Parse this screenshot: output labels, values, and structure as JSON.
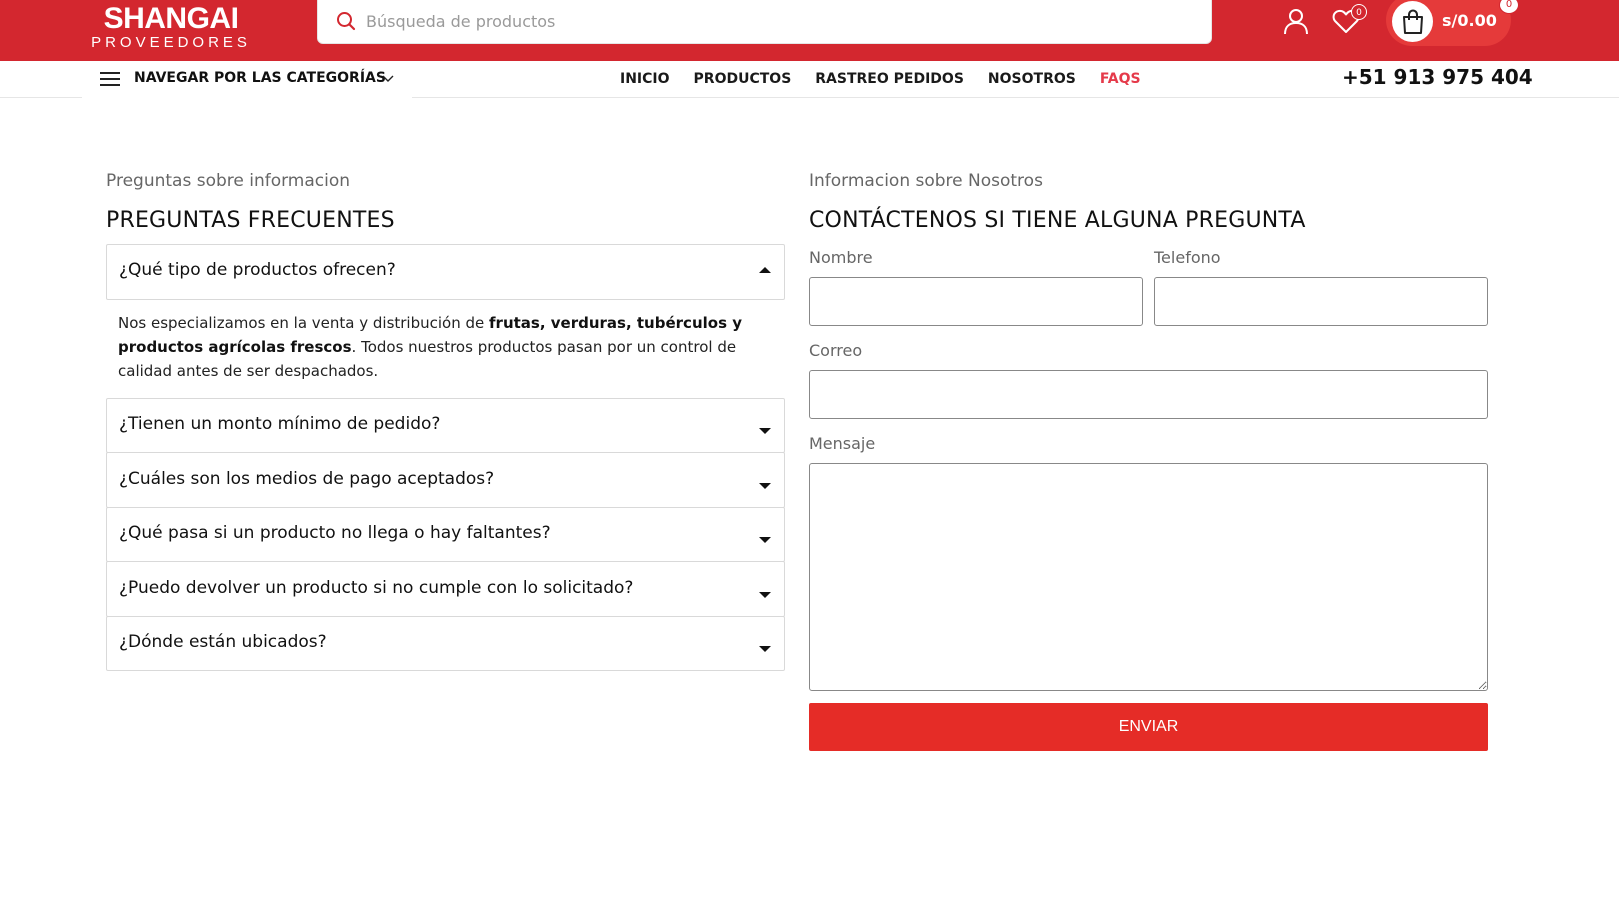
{
  "header": {
    "logo_main": "SHANGAI",
    "logo_sub": "PROVEEDORES",
    "search_placeholder": "Búsqueda de productos",
    "wishlist_count": "0",
    "cart_total": "s/0.00",
    "cart_count": "0",
    "brand_color": "#d3272f"
  },
  "nav": {
    "categories_label": "NAVEGAR POR LAS CATEGORÍAS",
    "links": [
      "INICIO",
      "PRODUCTOS",
      "RASTREO PEDIDOS",
      "NOSOTROS",
      "FAQS"
    ],
    "active_link": "FAQS",
    "phone": "+51 913 975 404"
  },
  "faq": {
    "subtitle": "Preguntas sobre informacion",
    "title": "PREGUNTAS FRECUENTES",
    "items": [
      {
        "question": "¿Qué tipo de productos ofrecen?",
        "expanded": true
      },
      {
        "question": "¿Tienen un monto mínimo de pedido?",
        "expanded": false
      },
      {
        "question": "¿Cuáles son los medios de pago aceptados?",
        "expanded": false
      },
      {
        "question": "¿Qué pasa si un producto no llega o hay faltantes?",
        "expanded": false
      },
      {
        "question": "¿Puedo devolver un producto si no cumple con lo solicitado?",
        "expanded": false
      },
      {
        "question": "¿Dónde están ubicados?",
        "expanded": false
      }
    ],
    "answer": {
      "part1": "Nos especializamos en la venta y distribución de ",
      "bold": "frutas, verduras, tubérculos y productos agrícolas frescos",
      "part2": ". Todos nuestros productos pasan por un control de calidad antes de ser despachados."
    }
  },
  "contact": {
    "subtitle": "Informacion sobre Nosotros",
    "title": "CONTÁCTENOS SI TIENE ALGUNA PREGUNTA",
    "name_label": "Nombre",
    "phone_label": "Telefono",
    "email_label": "Correo",
    "message_label": "Mensaje",
    "submit_label": "ENVIAR",
    "submit_color": "#e52c27"
  }
}
